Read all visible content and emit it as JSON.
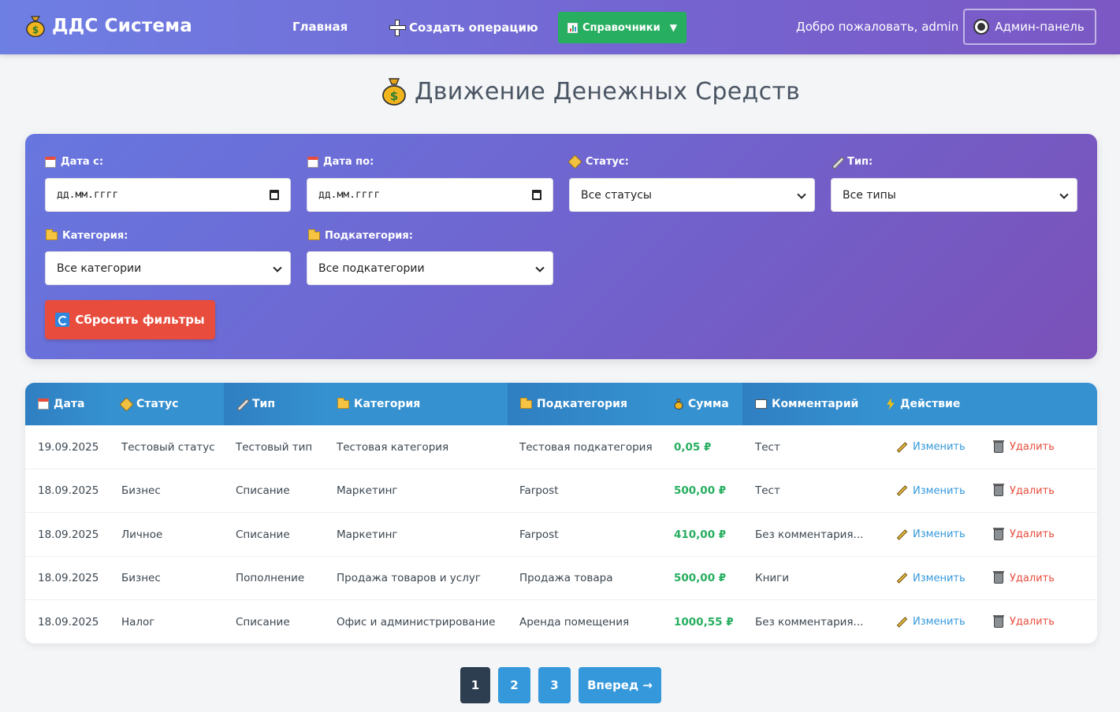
{
  "navbar": {
    "brand": "ДДС Система",
    "home": "Главная",
    "create": "Создать операцию",
    "references": "Справочники",
    "references_caret": "▼",
    "welcome": "Добро пожаловать, admin",
    "admin_panel": "Админ-панель"
  },
  "page": {
    "title": "Движение Денежных Средств"
  },
  "filters": {
    "date_from_label": "Дата с:",
    "date_from_placeholder": "дд.мм.гггг",
    "date_to_label": "Дата по:",
    "date_to_placeholder": "дд.мм.гггг",
    "status_label": "Статус:",
    "status_value": "Все статусы",
    "type_label": "Тип:",
    "type_value": "Все типы",
    "category_label": "Категория:",
    "category_value": "Все категории",
    "subcategory_label": "Подкатегория:",
    "subcategory_value": "Все подкатегории",
    "reset": "Сбросить фильтры"
  },
  "table": {
    "headers": [
      "Дата",
      "Статус",
      "Тип",
      "Категория",
      "Подкатегория",
      "Сумма",
      "Комментарий",
      "Действие"
    ],
    "edit_label": "Изменить",
    "delete_label": "Удалить",
    "rows": [
      {
        "date": "19.09.2025",
        "status": "Тестовый статус",
        "type": "Тестовый тип",
        "category": "Тестовая категория",
        "subcategory": "Тестовая подкатегория",
        "amount": "0,05 ₽",
        "comment": "Тест"
      },
      {
        "date": "18.09.2025",
        "status": "Бизнес",
        "type": "Списание",
        "category": "Маркетинг",
        "subcategory": "Farpost",
        "amount": "500,00 ₽",
        "comment": "Тест"
      },
      {
        "date": "18.09.2025",
        "status": "Личное",
        "type": "Списание",
        "category": "Маркетинг",
        "subcategory": "Farpost",
        "amount": "410,00 ₽",
        "comment": "Без комментария..."
      },
      {
        "date": "18.09.2025",
        "status": "Бизнес",
        "type": "Пополнение",
        "category": "Продажа товаров и услуг",
        "subcategory": "Продажа товара",
        "amount": "500,00 ₽",
        "comment": "Книги"
      },
      {
        "date": "18.09.2025",
        "status": "Налог",
        "type": "Списание",
        "category": "Офис и администрирование",
        "subcategory": "Аренда помещения",
        "amount": "1000,55 ₽",
        "comment": "Без комментария..."
      }
    ]
  },
  "pagination": {
    "pages": [
      "1",
      "2",
      "3"
    ],
    "active": "1",
    "next": "Вперед →"
  },
  "colors": {
    "accent": "#3498db",
    "success": "#27ae60",
    "danger": "#e74c3c",
    "header_blue": "#3591d0",
    "dark": "#2c3e50"
  }
}
